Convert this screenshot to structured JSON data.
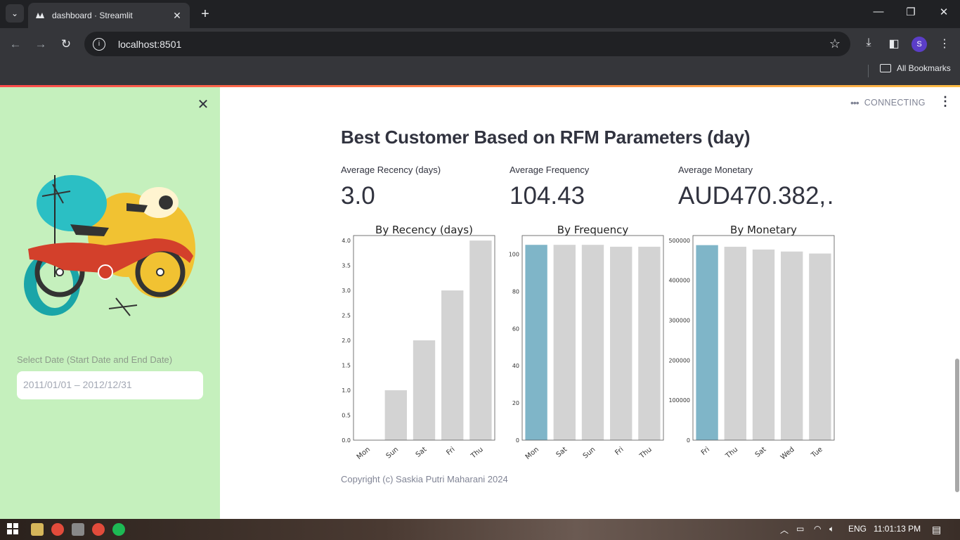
{
  "browser": {
    "tab_title": "dashboard · Streamlit",
    "url": "localhost:8501",
    "bookmarks_label": "All Bookmarks",
    "profile_initial": "S"
  },
  "app": {
    "status_text": "CONNECTING",
    "sidebar": {
      "date_label": "Select Date (Start Date and End Date)",
      "date_value": "2011/01/01 – 2012/12/31"
    },
    "heading": "Best Customer Based on RFM Parameters (day)",
    "metrics": [
      {
        "label": "Average Recency (days)",
        "value": "3.0"
      },
      {
        "label": "Average Frequency",
        "value": "104.43"
      },
      {
        "label": "Average Monetary",
        "value": "AUD470.382,…"
      }
    ],
    "copyright": "Copyright (c) Saskia Putri Maharani 2024"
  },
  "colors": {
    "sidebar_bg": "#c5f0bd",
    "highlight_bar": "#7fb5c8",
    "default_bar": "#d3d3d3"
  },
  "chart_data": [
    {
      "type": "bar",
      "title": "By Recency (days)",
      "categories": [
        "Mon",
        "Sun",
        "Sat",
        "Fri",
        "Thu"
      ],
      "values": [
        0.0,
        1.0,
        2.0,
        3.0,
        4.0
      ],
      "yticks": [
        "0.0",
        "0.5",
        "1.0",
        "1.5",
        "2.0",
        "2.5",
        "3.0",
        "3.5",
        "4.0"
      ],
      "ylim": [
        0,
        4.1
      ],
      "highlight_index": 0
    },
    {
      "type": "bar",
      "title": "By Frequency",
      "categories": [
        "Mon",
        "Sat",
        "Sun",
        "Fri",
        "Thu"
      ],
      "values": [
        105,
        105,
        105,
        104,
        104
      ],
      "yticks": [
        "0",
        "20",
        "40",
        "60",
        "80",
        "100"
      ],
      "ylim": [
        0,
        110
      ],
      "highlight_index": 0
    },
    {
      "type": "bar",
      "title": "By Monetary",
      "categories": [
        "Fri",
        "Thu",
        "Sat",
        "Wed",
        "Tue"
      ],
      "values": [
        488000,
        484000,
        477000,
        472000,
        467000
      ],
      "yticks": [
        "0",
        "100000",
        "200000",
        "300000",
        "400000",
        "500000"
      ],
      "ylim": [
        0,
        512000
      ],
      "highlight_index": 0
    }
  ],
  "taskbar": {
    "language": "ENG",
    "time": "11:01:13 PM"
  }
}
